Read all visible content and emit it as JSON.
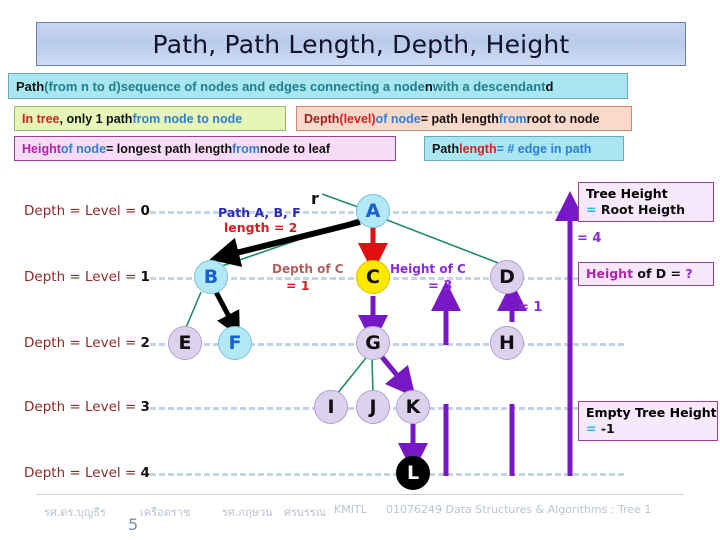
{
  "title": "Path, Path Length, Depth, Height",
  "definitions": {
    "path": {
      "p1": "Path ",
      "p2": "(from n to d)",
      "p3": " sequence of nodes and edges connecting a node ",
      "p4": "n",
      "p5": " with a descendant ",
      "p6": "d"
    },
    "in_tree": {
      "p1": "In tree",
      "p2": ", only 1 path ",
      "p3": "from node to node"
    },
    "depth": {
      "p1": "Depth ",
      "p2": "(level)",
      "p3": " of node ",
      "p4": "= path length ",
      "p5": "from ",
      "p6": "root to node"
    },
    "height": {
      "p1": "Height",
      "p2": " of node ",
      "p3": "= longest path length ",
      "p4": "from ",
      "p5": "node to leaf"
    },
    "path_length": {
      "p1": "Path ",
      "p2": "length ",
      "p3": "= # edge in path"
    }
  },
  "levels": [
    {
      "label_pre": "Depth = Level = ",
      "value": "0"
    },
    {
      "label_pre": "Depth = Level = ",
      "value": "1"
    },
    {
      "label_pre": "Depth = Level = ",
      "value": "2"
    },
    {
      "label_pre": "Depth = Level = ",
      "value": "3"
    },
    {
      "label_pre": "Depth = Level = ",
      "value": "4"
    }
  ],
  "nodes": [
    {
      "id": "A",
      "label": "A",
      "color": "blue"
    },
    {
      "id": "B",
      "label": "B",
      "color": "blue"
    },
    {
      "id": "C",
      "label": "C",
      "color": "yellow"
    },
    {
      "id": "D",
      "label": "D",
      "color": "lavender"
    },
    {
      "id": "E",
      "label": "E",
      "color": "lavender"
    },
    {
      "id": "F",
      "label": "F",
      "color": "blue"
    },
    {
      "id": "G",
      "label": "G",
      "color": "lavender"
    },
    {
      "id": "H",
      "label": "H",
      "color": "lavender"
    },
    {
      "id": "I",
      "label": "I",
      "color": "lavender"
    },
    {
      "id": "J",
      "label": "J",
      "color": "lavender"
    },
    {
      "id": "K",
      "label": "K",
      "color": "lavender"
    },
    {
      "id": "L",
      "label": "L",
      "color": "black"
    }
  ],
  "root_pointer_label": "r",
  "annotations": {
    "path_abf": "Path  A, B, F",
    "path_abf_length": "length  =  2",
    "depth_of_c": "Depth of C",
    "depth_of_c_value": "=  1",
    "height_of_c": "Height of C",
    "height_of_c_value": "=  3",
    "height_of_d_value": "=  1",
    "tree_height_value": "=  4"
  },
  "side_boxes": {
    "tree_height": {
      "line1": "Tree Height",
      "eq": "= ",
      "line2": "Root Heigth"
    },
    "height_of_d": {
      "p1": "Height",
      "p2": " of D = ",
      "p3": "?"
    },
    "empty_tree": {
      "line1": "Empty Tree Height",
      "eq": "= ",
      "value": "-1"
    }
  },
  "footer": {
    "author1": "รศ.ดร.บุญธีร",
    "author2": "เครือตราช",
    "author3": "รศ.กฤษวน",
    "author4": "ศรบรรณ",
    "institution": "KMITL",
    "course": "01076249 Data Structures & Algorithms : Tree 1",
    "page_number": "5"
  },
  "colors": {
    "title_bg": "#c7d6f0",
    "node_blue": "#b3e8f7",
    "node_yellow": "#ffe800",
    "node_lavender": "#ddd2ee",
    "edge_green": "#1f8f5f",
    "arrow_purple": "#7718c4",
    "arrow_red": "#e01010",
    "level_line": "#c3d3e8"
  }
}
